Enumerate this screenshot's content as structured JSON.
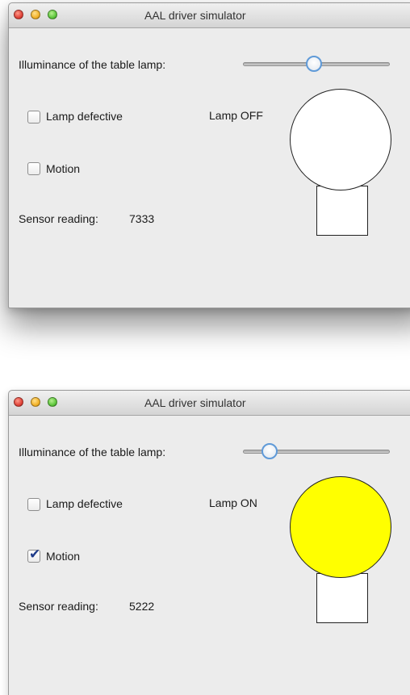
{
  "windows": [
    {
      "title": "AAL driver simulator",
      "illuminance_label": "Illuminance of the table lamp:",
      "illuminance_value": 0.48,
      "lamp_defective": {
        "label": "Lamp defective",
        "checked": false
      },
      "motion": {
        "label": "Motion",
        "checked": false
      },
      "lamp_status": "Lamp OFF",
      "bulb_color": "#ffffff",
      "sensor_label": "Sensor reading:",
      "sensor_value": "7333"
    },
    {
      "title": "AAL driver simulator",
      "illuminance_label": "Illuminance of the table lamp:",
      "illuminance_value": 0.14,
      "lamp_defective": {
        "label": "Lamp defective",
        "checked": false
      },
      "motion": {
        "label": "Motion",
        "checked": true
      },
      "lamp_status": "Lamp ON",
      "bulb_color": "#ffff00",
      "sensor_label": "Sensor reading:",
      "sensor_value": "5222"
    }
  ],
  "colors": {
    "window_bg": "#ececec",
    "slider_accent": "#5f9ad8",
    "checkmark": "#1f3c8a"
  }
}
